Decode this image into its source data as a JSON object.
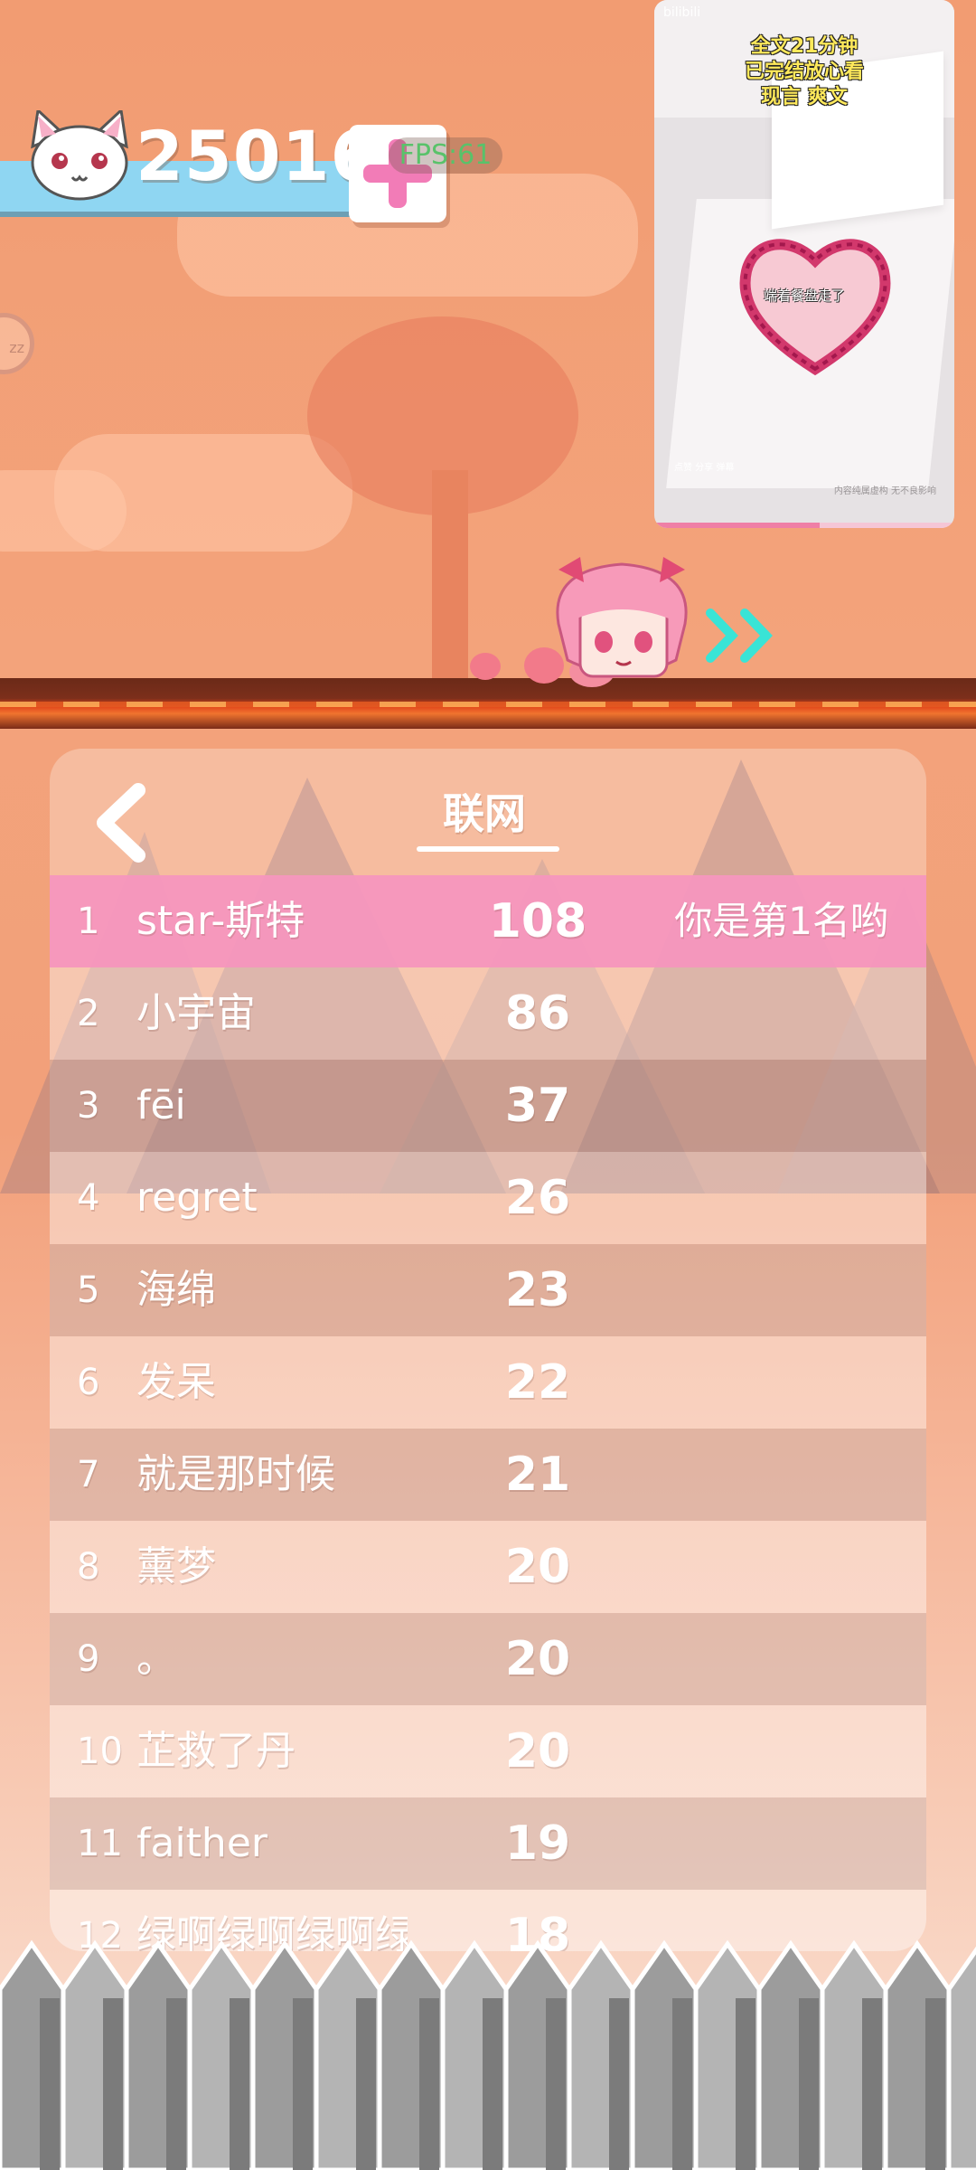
{
  "hud": {
    "score": "25016",
    "fps": "FPS:61",
    "icons": [
      "cat-face-icon",
      "plus-icon"
    ]
  },
  "video": {
    "brand": "bilibili",
    "caption": [
      "全文21分钟",
      "已完结放心看",
      "现言 爽文"
    ],
    "subtitle": "端着餐盘走了",
    "bottom_left": "点赞 分享 弹幕",
    "bottom_right": "内容纯属虚构 无不良影响",
    "progress": 0.55
  },
  "leaderboard": {
    "tab_label": "联网",
    "rows": [
      {
        "rank": "1",
        "name": "star-斯特",
        "score": "108",
        "note": "你是第1名哟"
      },
      {
        "rank": "2",
        "name": "小宇宙",
        "score": "86",
        "note": ""
      },
      {
        "rank": "3",
        "name": "fēi",
        "score": "37",
        "note": ""
      },
      {
        "rank": "4",
        "name": "regret",
        "score": "26",
        "note": ""
      },
      {
        "rank": "5",
        "name": "海绵",
        "score": "23",
        "note": ""
      },
      {
        "rank": "6",
        "name": "发呆",
        "score": "22",
        "note": ""
      },
      {
        "rank": "7",
        "name": "就是那时候",
        "score": "21",
        "note": ""
      },
      {
        "rank": "8",
        "name": "薰梦",
        "score": "20",
        "note": ""
      },
      {
        "rank": "9",
        "name": "。",
        "score": "20",
        "note": ""
      },
      {
        "rank": "10",
        "name": "芷救了丹",
        "score": "20",
        "note": ""
      },
      {
        "rank": "11",
        "name": "faither",
        "score": "19",
        "note": ""
      },
      {
        "rank": "12",
        "name": "绿啊绿啊绿啊绿绿",
        "score": "18",
        "note": ""
      }
    ]
  },
  "colors": {
    "sky": "#f29c72",
    "score_bar": "#8fd6f2",
    "highlight_row": "#f696be",
    "plus": "#f27cb7",
    "fps_text": "#59c26a"
  }
}
